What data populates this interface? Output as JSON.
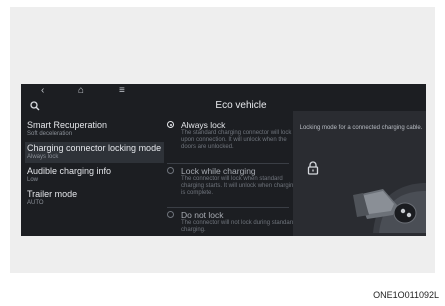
{
  "topbar": {
    "back_glyph": "‹",
    "home_glyph": "⌂",
    "menu_glyph": "≡"
  },
  "header": {
    "title": "Eco vehicle"
  },
  "menu": [
    {
      "label": "Smart Recuperation",
      "sub": "Soft deceleration"
    },
    {
      "label": "Charging connector locking mode",
      "sub": "Always lock"
    },
    {
      "label": "Audible charging info",
      "sub": "Low"
    },
    {
      "label": "Trailer mode",
      "sub": "AUTO"
    }
  ],
  "options": [
    {
      "label": "Always lock",
      "desc": "The standard charging connector will lock upon connection. It will unlock when the doors are unlocked.",
      "selected": true
    },
    {
      "label": "Lock while charging",
      "desc": "The connector will lock when standard charging starts. It will unlock when charging is complete.",
      "selected": false
    },
    {
      "label": "Do not lock",
      "desc": "The connector will not lock during standard charging.",
      "selected": false
    }
  ],
  "preview": {
    "caption": "Locking mode for a connected charging cable."
  },
  "footer": {
    "code": "ONE1O011092L"
  },
  "icons": [
    "back-icon",
    "home-icon",
    "menu-icon",
    "search-icon",
    "lock-icon",
    "charging-plug-illustration"
  ],
  "colors": {
    "screen_bg": "#1c1e22",
    "panel_bg": "#2a2c31",
    "text": "#e4e6ea",
    "muted": "#8a8f97"
  }
}
